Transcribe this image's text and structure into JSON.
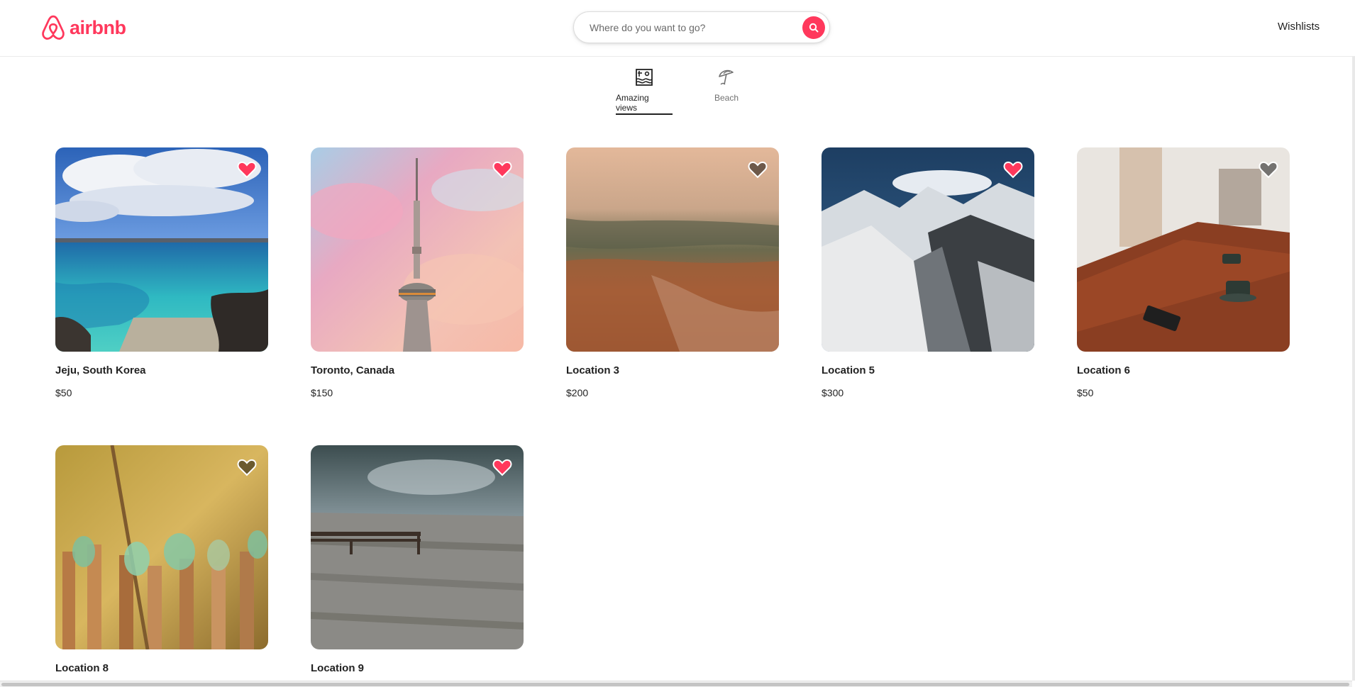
{
  "brand": {
    "name": "airbnb",
    "color": "#ff385c"
  },
  "search": {
    "placeholder": "Where do you want to go?",
    "icon": "search-icon"
  },
  "nav": {
    "wishlists_label": "Wishlists"
  },
  "categories": [
    {
      "label": "Amazing views",
      "icon": "amazing-views-icon",
      "active": true
    },
    {
      "label": "Beach",
      "icon": "beach-umbrella-icon",
      "active": false
    }
  ],
  "listings": [
    {
      "title": "Jeju, South Korea",
      "price": "$50",
      "favorited": true
    },
    {
      "title": "Toronto, Canada",
      "price": "$150",
      "favorited": true
    },
    {
      "title": "Location 3",
      "price": "$200",
      "favorited": false
    },
    {
      "title": "Location 5",
      "price": "$300",
      "favorited": true
    },
    {
      "title": "Location 6",
      "price": "$50",
      "favorited": false
    },
    {
      "title": "Location 8",
      "price": "",
      "favorited": false
    },
    {
      "title": "Location 9",
      "price": "",
      "favorited": true
    }
  ],
  "colors": {
    "heart_active": "#ff385c",
    "heart_inactive": "rgba(0,0,0,0.5)",
    "text": "#222222"
  }
}
